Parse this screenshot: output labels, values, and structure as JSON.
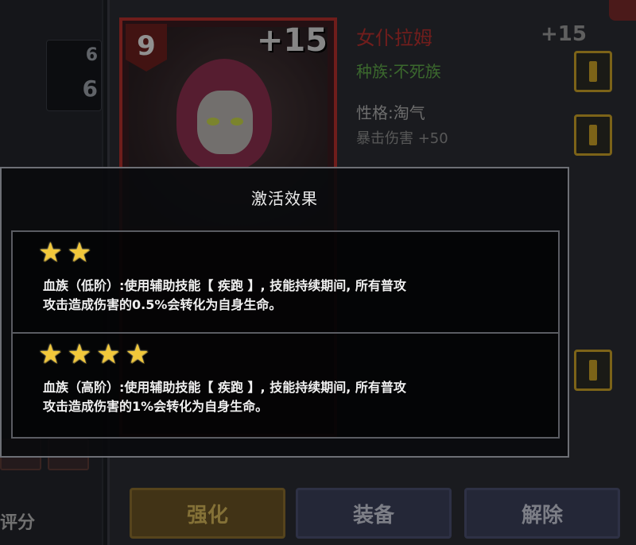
{
  "background": {
    "left_panel": {
      "number_1": "6",
      "number_2": "6",
      "bottom_label": "评分"
    },
    "card": {
      "level": "9",
      "plus": "+15"
    },
    "info": {
      "name": "女仆拉姆",
      "plus": "+15",
      "race": "种族:不死族",
      "trait": "性格:淘气",
      "trait_bonus": "暴击伤害 +50"
    },
    "buttons": {
      "enhance": "强化",
      "equip": "装备",
      "dismiss": "解除"
    }
  },
  "popup": {
    "title": "激活效果",
    "effects": [
      {
        "stars": "★★",
        "line1": "血族（低阶）:使用辅助技能【 疾跑 】, 技能持续期间, 所有普攻",
        "line2": "攻击造成伤害的0.5%会转化为自身生命。"
      },
      {
        "stars": "★★★★",
        "line1": "血族（高阶）:使用辅助技能【 疾跑 】, 技能持续期间, 所有普攻",
        "line2": "攻击造成伤害的1%会转化为自身生命。"
      }
    ]
  },
  "colors": {
    "star": "#f2c83a",
    "name_red": "#b6302e",
    "race_green": "#5fa84a",
    "lock_gold": "#c9a027"
  }
}
